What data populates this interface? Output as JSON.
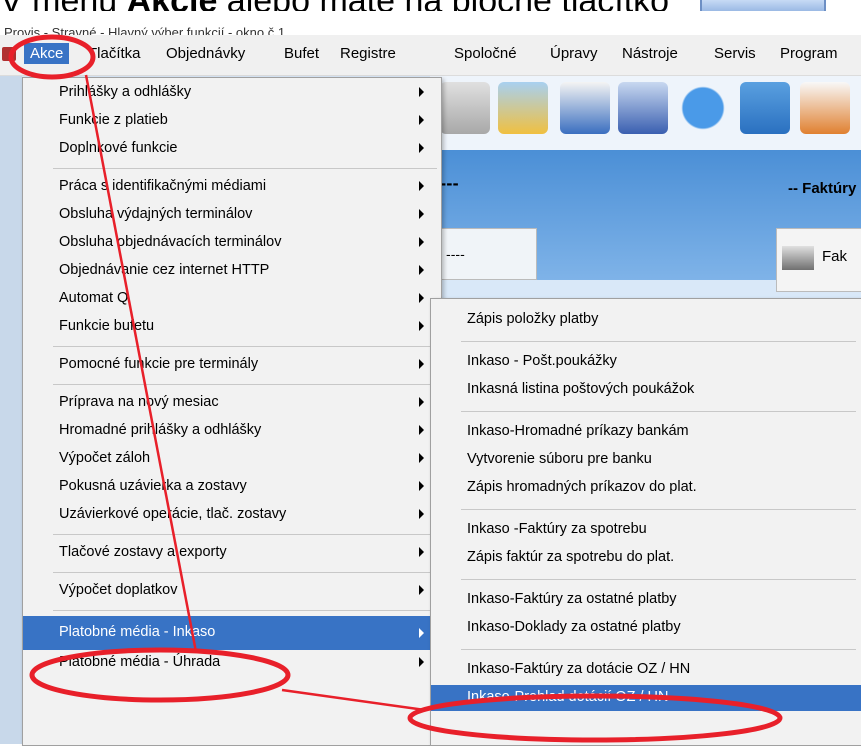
{
  "caption": {
    "text_before": "V menu ",
    "text_bold": "Akcie",
    "text_after": " alebo máte na ploche tlačítko"
  },
  "window": {
    "title": "Provis - Stravné - Hlavný výber funkcií - okno č.1"
  },
  "menubar": {
    "items": [
      "Akce",
      "Tlačítka",
      "Objednávky",
      "Bufet",
      "Registre",
      "Spoločné",
      "Úpravy",
      "Nástroje",
      "Servis",
      "Program"
    ]
  },
  "background": {
    "faktury_title": "-- Faktúry",
    "faktury_button": "Fak",
    "dashes_left": "---",
    "dashes_field": "----"
  },
  "main_menu": {
    "items": [
      {
        "label": "Prihlášky a odhlášky",
        "submenu": true
      },
      {
        "label": "Funkcie z platieb",
        "submenu": true
      },
      {
        "label": "Doplnkové funkcie",
        "submenu": true
      },
      {
        "separator": true
      },
      {
        "label": "Práca s identifikačnými médiami",
        "submenu": true
      },
      {
        "label": "Obsluha výdajných terminálov",
        "submenu": true
      },
      {
        "label": "Obsluha objednávacích terminálov",
        "submenu": true
      },
      {
        "label": "Objednávanie cez internet HTTP",
        "submenu": true
      },
      {
        "label": "Automat Q",
        "submenu": true
      },
      {
        "label": "Funkcie bufetu",
        "submenu": true
      },
      {
        "separator": true
      },
      {
        "label": "Pomocné funkcie pre terminály",
        "submenu": true
      },
      {
        "separator": true
      },
      {
        "label": "Príprava na nový mesiac",
        "submenu": true
      },
      {
        "label": "Hromadné prihlášky a odhlášky",
        "submenu": true
      },
      {
        "label": "Výpočet záloh",
        "submenu": true
      },
      {
        "label": "Pokusná uzávierka a zostavy",
        "submenu": true
      },
      {
        "label": "Uzávierkové operácie, tlač. zostavy",
        "submenu": true
      },
      {
        "separator": true
      },
      {
        "label": "Tlačové zostavy a exporty",
        "submenu": true
      },
      {
        "separator": true
      },
      {
        "label": "Výpočet doplatkov",
        "submenu": true
      },
      {
        "separator": true
      },
      {
        "label": "Platobné média - Inkaso",
        "submenu": true,
        "selected": true
      },
      {
        "label": "Platobné média - Úhrada",
        "submenu": true
      }
    ]
  },
  "sub_menu": {
    "items": [
      {
        "label": "Zápis položky platby"
      },
      {
        "separator": true
      },
      {
        "label": "Inkaso - Pošt.poukážky"
      },
      {
        "label": "Inkasná listina poštových poukážok"
      },
      {
        "separator": true
      },
      {
        "label": "Inkaso-Hromadné príkazy bankám"
      },
      {
        "label": "Vytvorenie súboru pre banku"
      },
      {
        "label": "Zápis hromadných príkazov do plat."
      },
      {
        "separator": true
      },
      {
        "label": "Inkaso -Faktúry za spotrebu"
      },
      {
        "label": "Zápis faktúr za spotrebu do plat."
      },
      {
        "separator": true
      },
      {
        "label": "Inkaso-Faktúry za ostatné platby"
      },
      {
        "label": "Inkaso-Doklady za ostatné platby"
      },
      {
        "separator": true
      },
      {
        "label": "Inkaso-Faktúry za dotácie OZ / HN"
      },
      {
        "label": "Inkaso-Prehlad dotácií OZ / HN",
        "selected": true
      }
    ]
  },
  "colors": {
    "highlight": "#3873c5",
    "annotation": "#e8202a"
  }
}
